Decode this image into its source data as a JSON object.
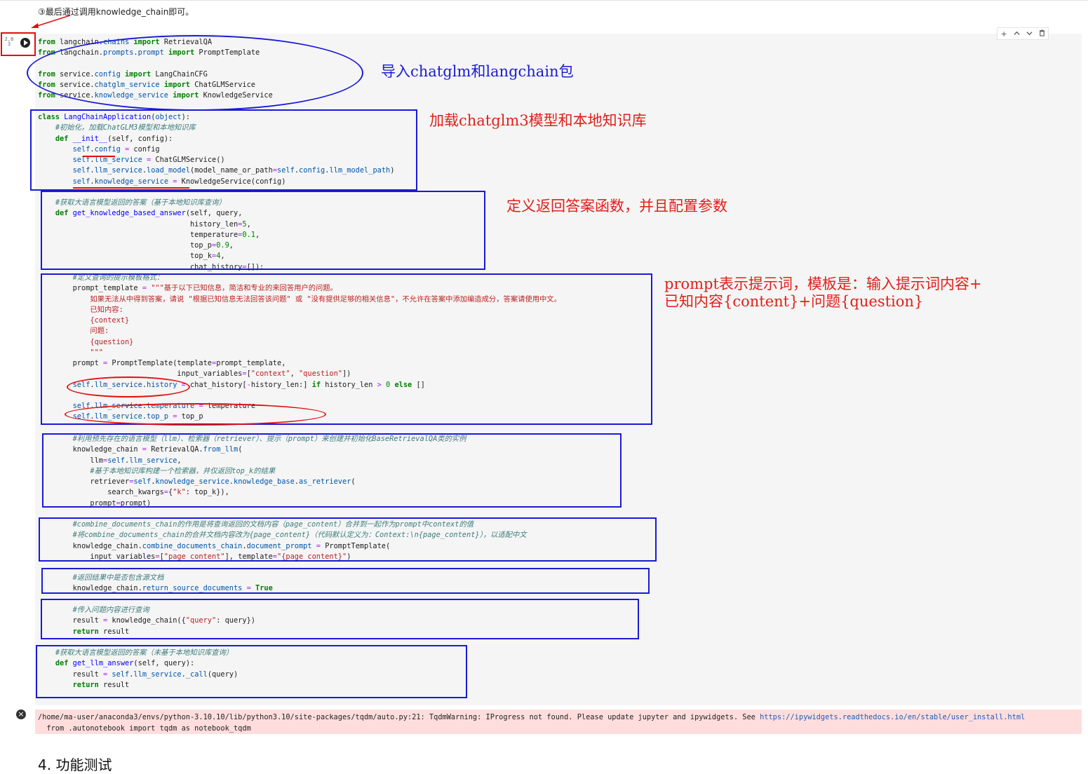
{
  "intro_text": "③最后通过调用knowledge_chain即可。",
  "cell": {
    "exec_count": "2,8\n3"
  },
  "toolbar": {
    "add_icon": "+",
    "up_icon": "^",
    "down_icon": "v",
    "delete_icon": "trash"
  },
  "annotations": {
    "import": "导入chatglm和langchain包",
    "load": "加载chatglm3模型和本地知识库",
    "define": "定义返回答案函数，并且配置参数",
    "prompt_line1": "prompt表示提示词，模板是：输入提示词内容+",
    "prompt_line2": "已知内容{content}+问题{question}"
  },
  "colors": {
    "box_blue": "#1a1ad6",
    "mark_red": "#e01010",
    "keyword_green": "#008000",
    "stderr_bg": "#ffdddd"
  },
  "stderr": {
    "line1": "/home/ma-user/anaconda3/envs/python-3.10.10/lib/python3.10/site-packages/tqdm/auto.py:21: TqdmWarning: IProgress not found. Please update jupyter and ipywidgets. See ",
    "link": "https://ipywidgets.readthedocs.io/en/stable/user_install.html",
    "line2": "  from .autonotebook import tqdm as notebook_tqdm"
  },
  "section_heading": "4. 功能测试"
}
